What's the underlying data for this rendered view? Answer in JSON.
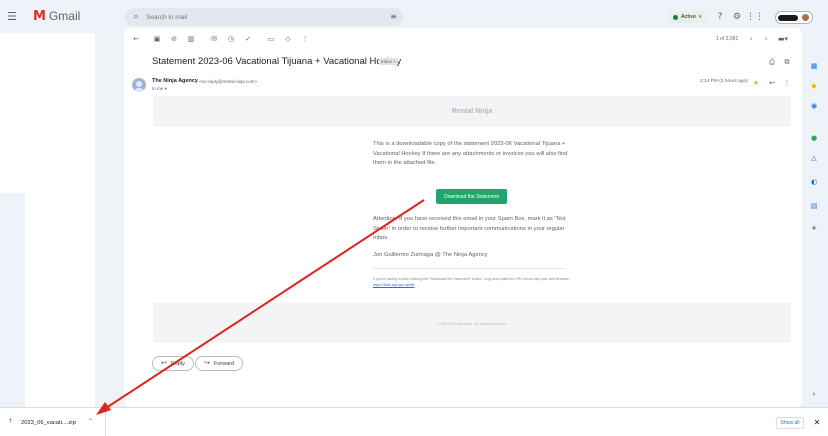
{
  "app": {
    "name": "Gmail"
  },
  "search": {
    "placeholder": "Search in mail"
  },
  "header": {
    "status_label": "Active"
  },
  "toolbar": {
    "page_count": "1 of 3,091"
  },
  "email": {
    "subject": "Statement 2023-06 Vacational Tijuana + Vacational Hockey",
    "label": "Inbox ×",
    "sender_name": "The Ninja Agency",
    "sender_email": "<no-reply@rental-ninja.com>",
    "to": "to me ▾",
    "timestamp": "2:14 PM (3 hours ago)"
  },
  "body": {
    "banner_title": "Rental Ninja",
    "intro": "This is a downloadable copy of the statement 2023-06 Vacational Tijuana + Vacational Hockey If there are any attachments or invoices you will also find them in the attached file.",
    "download_label": "Download the Statement",
    "attention": "Attention: If you have received this email in your Spam Box, mark it as \"Not Spam\" in order to receive further important communications in your regular Inbox.",
    "signature": "Jon Guillermo Zurinaga @ The Ninja Agency",
    "fallback_text": "If you're having trouble clicking the \"Download the Statement\" button, copy and paste the URL below into your web browser:",
    "fallback_link": "https://l0ab.app.goo.gl/d8f",
    "footer": "© 2023 Rental Ninja. All rights reserved."
  },
  "actions": {
    "reply_label": "Reply",
    "forward_label": "Forward"
  },
  "download_bar": {
    "file_name": "2023_06_vacati....zip",
    "show_all_label": "Show all"
  },
  "colors": {
    "accent": "#21a56b",
    "annotation_arrow": "#e0231b"
  },
  "icons": [
    "menu-icon",
    "gmail-logo",
    "search-icon",
    "tune-icon",
    "help-icon",
    "settings-icon",
    "apps-icon",
    "back-icon",
    "archive-icon",
    "report-icon",
    "delete-icon",
    "mail-icon",
    "snooze-icon",
    "add-task-icon",
    "move-icon",
    "label-icon",
    "more-icon",
    "print-icon",
    "open-new-icon",
    "star-icon",
    "reply-icon",
    "forward-icon",
    "calendar-icon",
    "keep-icon",
    "tasks-icon",
    "contacts-icon",
    "meet-icon",
    "add-icon",
    "file-icon",
    "chevron-up-icon",
    "close-icon"
  ]
}
